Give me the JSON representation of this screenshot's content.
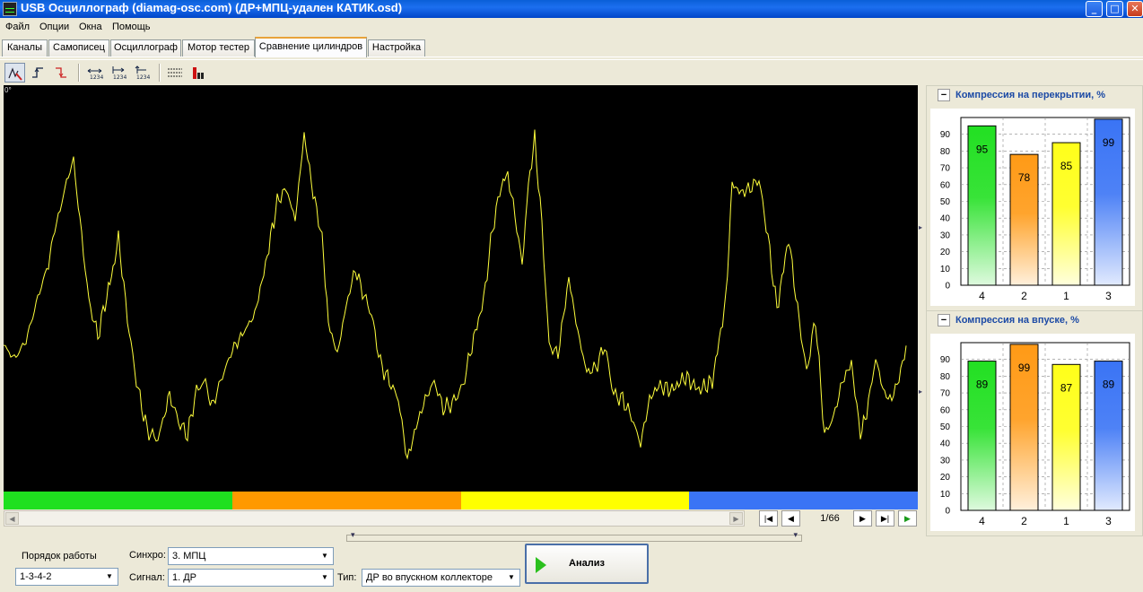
{
  "window": {
    "title": "USB Осциллограф (diamag-osc.com) (ДР+МПЦ-удален КАТИК.osd)"
  },
  "menu": [
    "Файл",
    "Опции",
    "Окна",
    "Помощь"
  ],
  "tabs": [
    {
      "label": "Каналы",
      "active": false
    },
    {
      "label": "Самописец",
      "active": false
    },
    {
      "label": "Осциллограф",
      "active": false
    },
    {
      "label": "Мотор тестер",
      "active": false
    },
    {
      "label": "Сравнение цилиндров",
      "active": true
    },
    {
      "label": "Настройка",
      "active": false
    }
  ],
  "toolbar": {
    "icons": [
      "cursor-wave-icon",
      "rising-edge-icon",
      "falling-edge-icon",
      "span-1234-icon",
      "shift-1234-icon",
      "marker-1234-icon",
      "grid-lines-icon",
      "bar-chart-icon"
    ]
  },
  "scope": {
    "angle_label": "0°",
    "trace_color": "#ffff3c",
    "cylinder_colors": [
      "#1fe01f",
      "#ff9900",
      "#ffff00",
      "#3a74f5"
    ]
  },
  "navigation": {
    "page": "1/66"
  },
  "charts": {
    "overlap": {
      "title": "Компрессия на перекрытии, %"
    },
    "intake": {
      "title": "Компрессия на впуске, %"
    }
  },
  "chart_data": [
    {
      "type": "bar",
      "title": "Компрессия на перекрытии, %",
      "categories": [
        "4",
        "2",
        "1",
        "3"
      ],
      "values": [
        95,
        78,
        85,
        99
      ],
      "colors": [
        "#22e022",
        "#ff9a16",
        "#ffff1a",
        "#3a74f5"
      ],
      "ylim": [
        0,
        100
      ],
      "yticks": [
        0,
        10,
        20,
        30,
        40,
        50,
        60,
        70,
        80,
        90
      ],
      "grid": true
    },
    {
      "type": "bar",
      "title": "Компрессия на впуске, %",
      "categories": [
        "4",
        "2",
        "1",
        "3"
      ],
      "values": [
        89,
        99,
        87,
        89
      ],
      "colors": [
        "#22e022",
        "#ff9a16",
        "#ffff1a",
        "#3a74f5"
      ],
      "ylim": [
        0,
        100
      ],
      "yticks": [
        0,
        10,
        20,
        30,
        40,
        50,
        60,
        70,
        80,
        90
      ],
      "grid": true
    }
  ],
  "controls": {
    "firing_order_label": "Порядок работы",
    "firing_order_value": "1-3-4-2",
    "sync_label": "Синхро:",
    "sync_value": "3.  МПЦ",
    "signal_label": "Сигнал:",
    "signal_value": "1.  ДР",
    "type_label": "Тип:",
    "type_value": "ДР во впускном коллекторе",
    "analyze_button": "Анализ"
  }
}
